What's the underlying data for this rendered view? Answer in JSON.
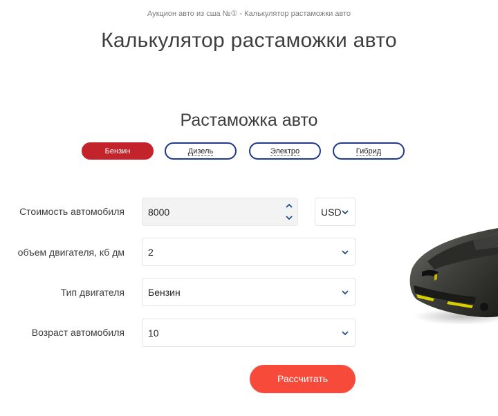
{
  "breadcrumb": "Аукцион авто из сша №① - Калькулятор растаможки авто",
  "page_title": "Калькулятор растаможки авто",
  "section_title": "Растаможка авто",
  "fuel_tabs": [
    {
      "label": "Бензин",
      "active": true
    },
    {
      "label": "Дизель",
      "active": false
    },
    {
      "label": "Электро",
      "active": false
    },
    {
      "label": "Гибрид",
      "active": false
    }
  ],
  "form": {
    "price": {
      "label": "Стоимость автомобиля",
      "value": "8000",
      "currency": "USD"
    },
    "engine_volume": {
      "label": "объем двигателя, кб дм",
      "value": "2"
    },
    "engine_type": {
      "label": "Тип двигателя",
      "value": "Бензин"
    },
    "car_age": {
      "label": "Возраст автомобиля",
      "value": "10"
    }
  },
  "submit_label": "Рассчитать",
  "colors": {
    "active_tab": "#c3232b",
    "tab_border": "#1f3a8c",
    "submit": "#f74a3a",
    "chevron": "#1f4e8c"
  }
}
